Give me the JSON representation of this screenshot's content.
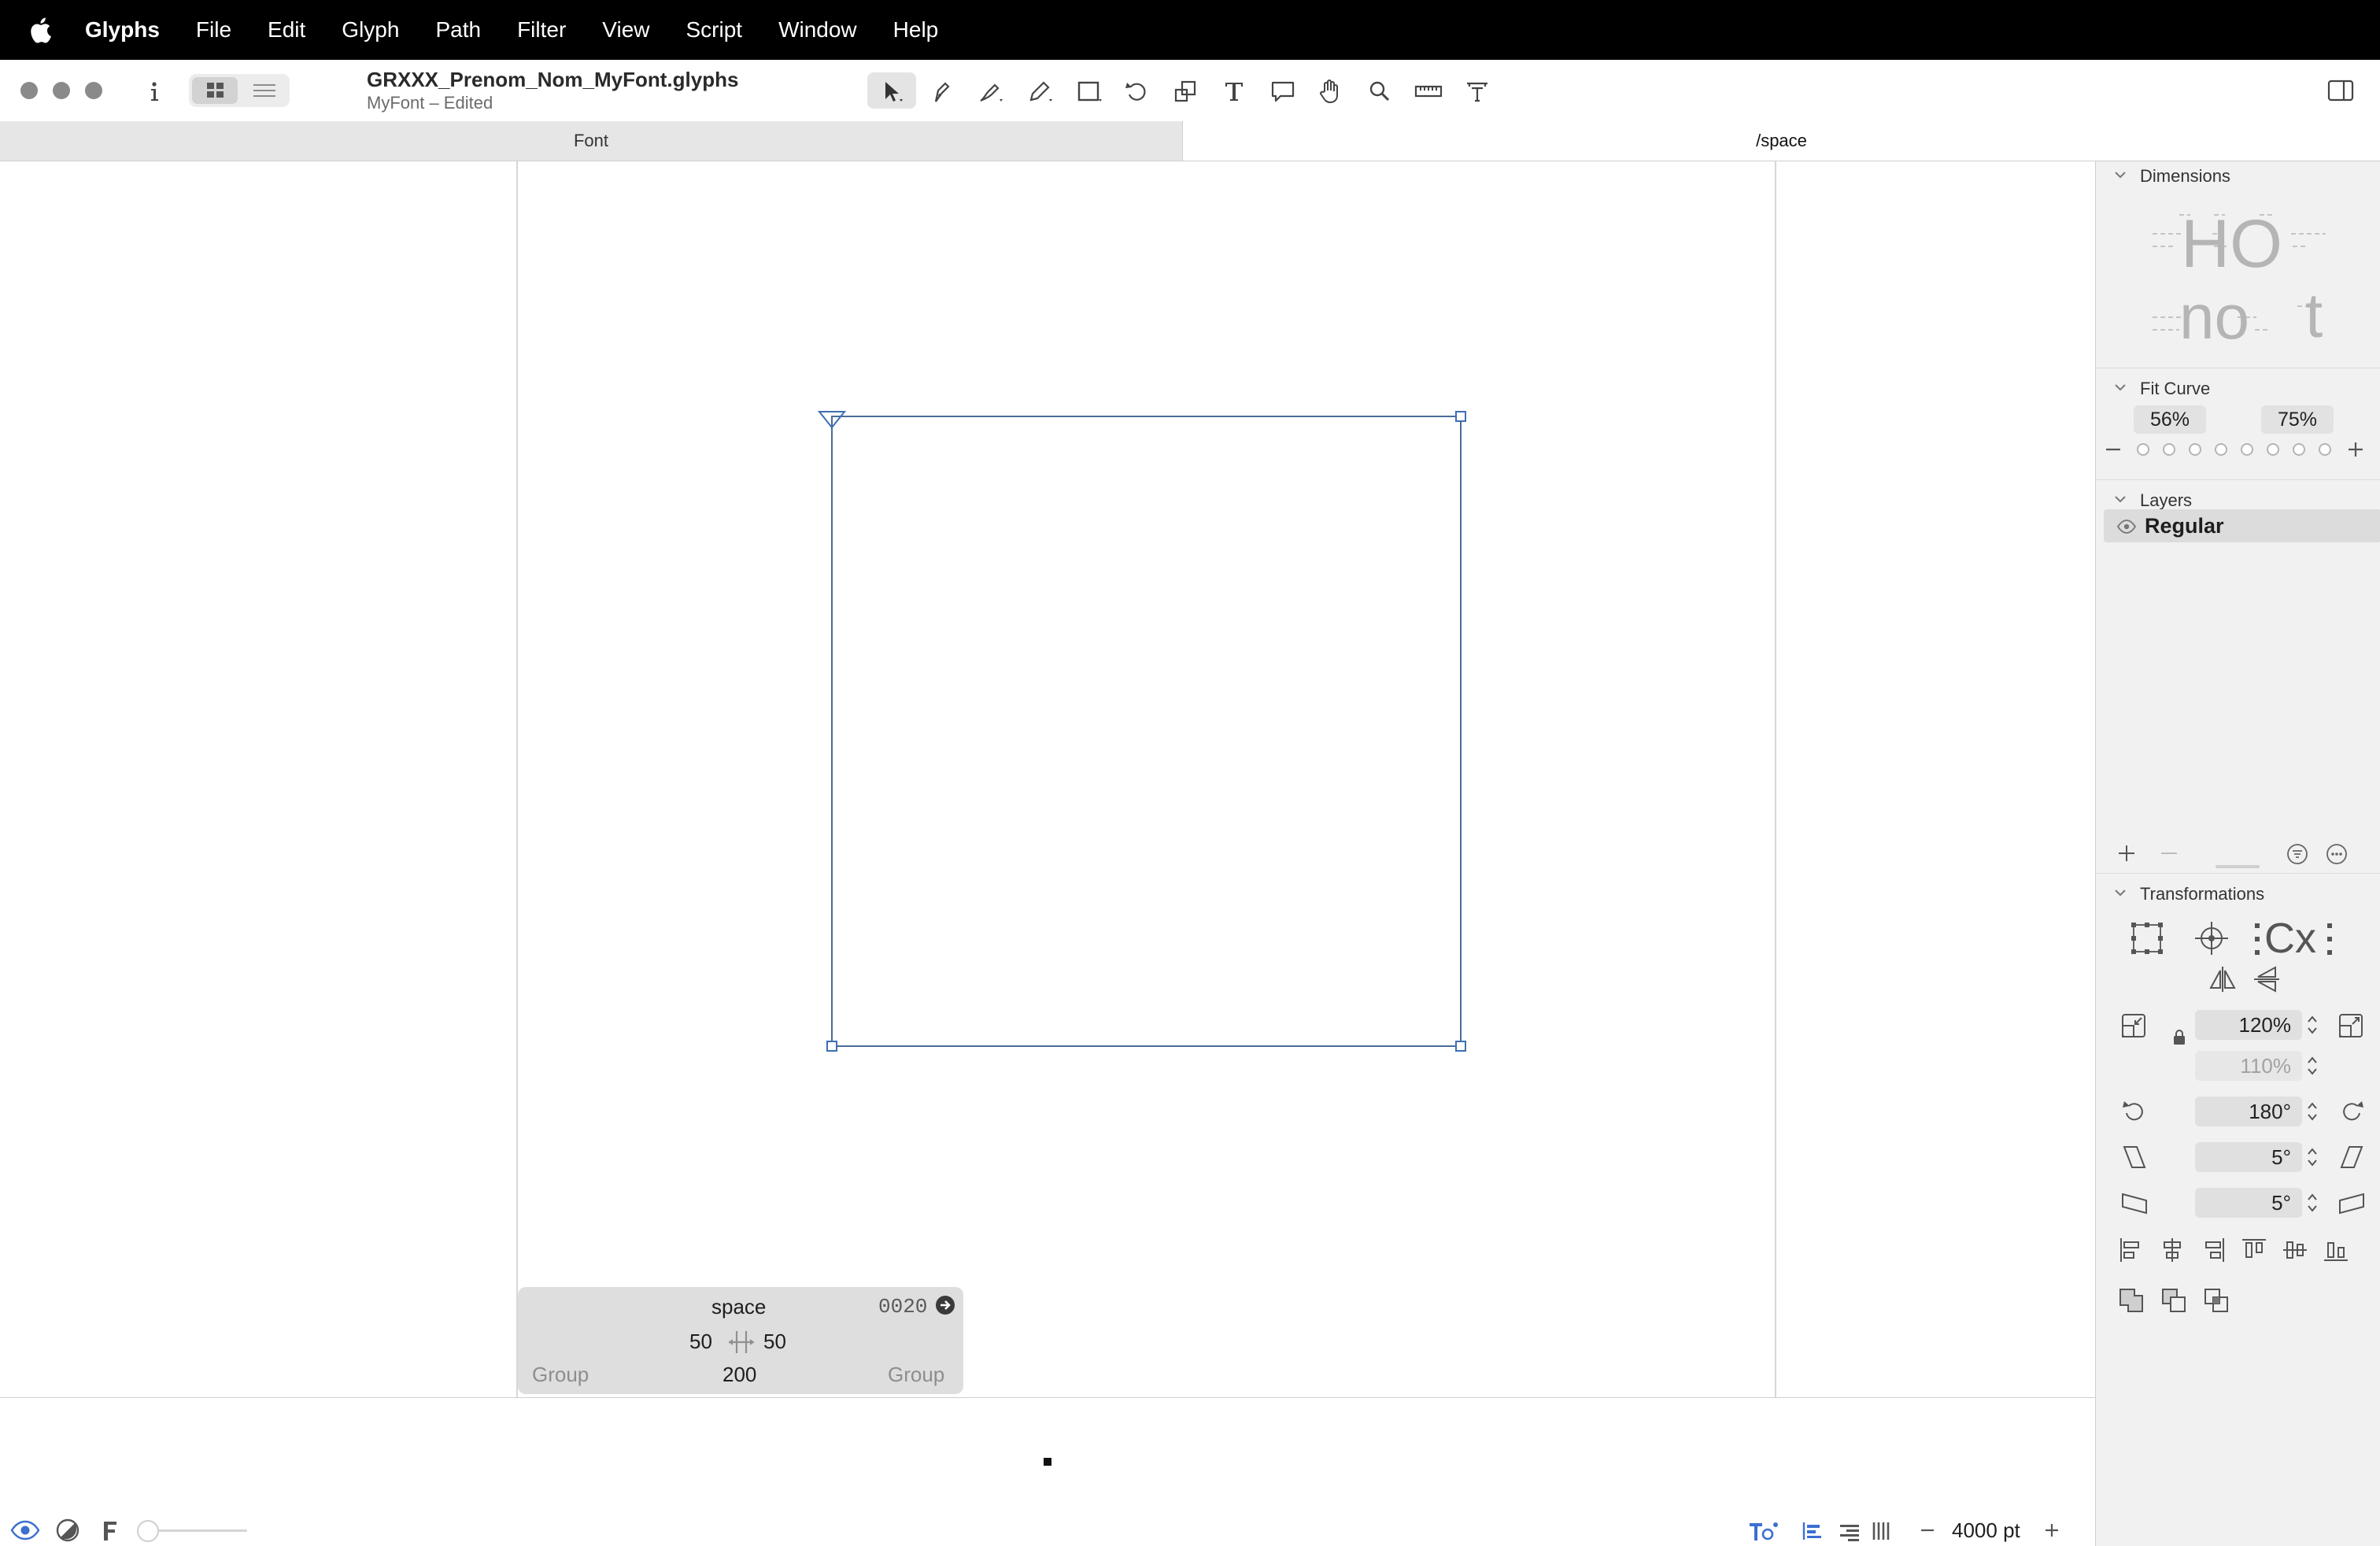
{
  "menubar": {
    "app_name": "Glyphs",
    "items": [
      "File",
      "Edit",
      "Glyph",
      "Path",
      "Filter",
      "View",
      "Script",
      "Window",
      "Help"
    ]
  },
  "toolbar": {
    "document_title": "GRXXX_Prenom_Nom_MyFont.glyphs",
    "document_subtitle": "MyFont – Edited",
    "tools": [
      "select-tool",
      "draw-tool",
      "pen-tool",
      "pencil-tool",
      "rectangle-tool",
      "rotate-tool",
      "scale-tool",
      "text-tool",
      "annotation-tool",
      "hand-tool",
      "zoom-tool",
      "measure-tool",
      "metrics-tool"
    ]
  },
  "tabs": {
    "font": "Font",
    "active": "/space"
  },
  "glyph_info": {
    "name": "space",
    "unicode": "0020",
    "left_sidebearing": "50",
    "right_sidebearing": "50",
    "width": "200",
    "left_group": "Group",
    "right_group": "Group"
  },
  "sidebar": {
    "dimensions": {
      "title": "Dimensions",
      "preview_top": "HO",
      "preview_bottom_left": "no",
      "preview_bottom_right": "t"
    },
    "fit_curve": {
      "title": "Fit Curve",
      "min": "56%",
      "max": "75%"
    },
    "layers": {
      "title": "Layers",
      "items": [
        "Regular"
      ]
    },
    "transformations": {
      "title": "Transformations",
      "preview_text": "Cx",
      "scale_x": "120%",
      "scale_y": "110%",
      "rotate": "180°",
      "slant_h": "5°",
      "slant_v": "5°"
    }
  },
  "bottombar": {
    "zoom": "4000 pt"
  },
  "colors": {
    "menubar": "#000000",
    "canvas": "#ffffff",
    "sidebar": "#f1f1f1",
    "outline": "#4b6c99",
    "node": "#3d6fb5"
  }
}
